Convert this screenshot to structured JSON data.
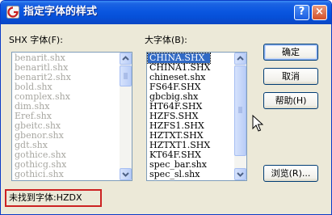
{
  "window": {
    "title": "指定字体的样式",
    "help_label": "?",
    "close_label": "×"
  },
  "shx_list": {
    "label": "SHX 字体(F):",
    "items": [
      "benarit.shx",
      "benaritl.shx",
      "benarit2.shx",
      "bold.shx",
      "complex.shx",
      "dim.shx",
      "Eref.shx",
      "gbeitc.shx",
      "gbenor.shx",
      "gdt.shx",
      "gothice.shx",
      "gothicg.shx",
      "gothici.shx"
    ]
  },
  "big_list": {
    "label": "大字体(B):",
    "items": [
      "CHINA.SHX",
      "CHINA1.SHX",
      "chineset.shx",
      "FS64F.SHX",
      "gbcbig.shx",
      "HT64F.SHX",
      "HZFS.SHX",
      "HZFS1.SHX",
      "HZTXT.SHX",
      "HZTXT1.SHX",
      "KT64F.SHX",
      "spec_bar.shx",
      "spec_sl.shx"
    ],
    "selected": "CHINA.SHX"
  },
  "buttons": {
    "ok": "确定",
    "cancel": "取消",
    "help": "帮助(H)",
    "browse": "浏览(R)..."
  },
  "status": {
    "text": "未找到字体:HZDX",
    "highlight_color": "#cc2222"
  },
  "icons": {
    "app": "autocad-icon",
    "cursor": "mouse-pointer-icon"
  }
}
